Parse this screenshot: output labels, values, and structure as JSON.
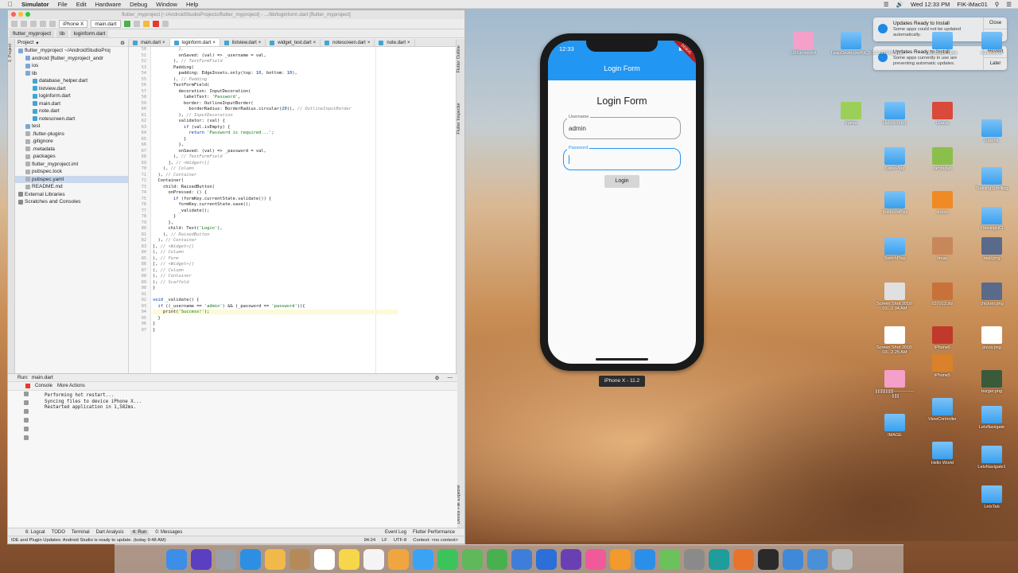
{
  "menubar": {
    "app": "Simulator",
    "menus": [
      "File",
      "Edit",
      "Hardware",
      "Debug",
      "Window",
      "Help"
    ],
    "datetime": "Wed 12:33 PM",
    "user": "FIK-iMac01"
  },
  "ide": {
    "title": "flutter_myproject [~/AndroidStudioProjects/flutter_myproject] - .../lib/loginform.dart [flutter_myproject]",
    "toolbar": {
      "device": "iPhone X",
      "run_config": "main.dart"
    },
    "breadcrumbs": [
      "flutter_myproject",
      "lib",
      "loginform.dart"
    ],
    "project_header": "Project",
    "tree": [
      {
        "label": "flutter_myproject  ~/AndroidStudioProj",
        "indent": 0,
        "kind": "folder"
      },
      {
        "label": "android [flutter_myproject_andr",
        "indent": 1,
        "kind": "folder"
      },
      {
        "label": "ios",
        "indent": 1,
        "kind": "folder"
      },
      {
        "label": "lib",
        "indent": 1,
        "kind": "folder"
      },
      {
        "label": "database_helper.dart",
        "indent": 2,
        "kind": "dart"
      },
      {
        "label": "listview.dart",
        "indent": 2,
        "kind": "dart"
      },
      {
        "label": "loginform.dart",
        "indent": 2,
        "kind": "dart"
      },
      {
        "label": "main.dart",
        "indent": 2,
        "kind": "dart"
      },
      {
        "label": "note.dart",
        "indent": 2,
        "kind": "dart"
      },
      {
        "label": "notescreen.dart",
        "indent": 2,
        "kind": "dart"
      },
      {
        "label": "test",
        "indent": 1,
        "kind": "folder"
      },
      {
        "label": ".flutter-plugins",
        "indent": 1,
        "kind": "file"
      },
      {
        "label": ".gitignore",
        "indent": 1,
        "kind": "file"
      },
      {
        "label": ".metadata",
        "indent": 1,
        "kind": "file"
      },
      {
        "label": ".packages",
        "indent": 1,
        "kind": "file"
      },
      {
        "label": "flutter_myproject.iml",
        "indent": 1,
        "kind": "file"
      },
      {
        "label": "pubspec.lock",
        "indent": 1,
        "kind": "file"
      },
      {
        "label": "pubspec.yaml",
        "indent": 1,
        "kind": "file",
        "selected": true
      },
      {
        "label": "README.md",
        "indent": 1,
        "kind": "file"
      },
      {
        "label": "External Libraries",
        "indent": 0,
        "kind": "lib"
      },
      {
        "label": "Scratches and Consoles",
        "indent": 0,
        "kind": "lib"
      }
    ],
    "tabs": [
      "main.dart",
      "loginform.dart",
      "listview.dart",
      "widget_test.dart",
      "notescreen.dart",
      "note.dart"
    ],
    "active_tab": "loginform.dart",
    "side_labels_left": [
      "1: Project",
      "Build Variants",
      "Layout Captures",
      "2: Structure",
      "2: Favorites"
    ],
    "side_labels_right": [
      "Flutter Outline",
      "Flutter Inspector",
      "Device File Explorer"
    ],
    "run": {
      "label": "Run:",
      "config": "main.dart",
      "console_tab": "Console",
      "more_actions": "More Actions",
      "output": [
        "Performing hot restart...",
        "Syncing files to device iPhone X...",
        "Restarted application in 1,582ms."
      ]
    },
    "bottom_tabs": [
      "6: Logcat",
      "TODO",
      "Terminal",
      "Dart Analysis",
      "4: Run",
      "0: Messages"
    ],
    "bottom_right_tabs": [
      "Event Log",
      "Flutter Performance"
    ],
    "status": {
      "message": "IDE and Plugin Updates: Android Studio is ready to update. (today 9:48 AM)",
      "position": "94:24",
      "line_sep": "LF",
      "encoding": "UTF-8",
      "context": "Context: <no context>"
    }
  },
  "simulator": {
    "time": "12:33",
    "app_title": "Login Form",
    "form_title": "Login Form",
    "username_label": "Username",
    "username_value": "admin",
    "password_label": "Password",
    "login_button": "Login",
    "device_label": "iPhone X - 11.2",
    "debug_banner": "DEBUG"
  },
  "notifications": [
    {
      "title": "Updates Ready to Install",
      "body": "Some apps could not be updated automatically.",
      "action1": "Close",
      "action2": "Details"
    },
    {
      "title": "Updates Ready to Install",
      "body": "Some apps currently in use are preventing automatic updates.",
      "action1": "Restart",
      "action2": "Later"
    }
  ],
  "desktop_icons": [
    {
      "label": "LMGimmick4",
      "kind": "app"
    },
    {
      "label": "LeapDeveloperKit_2.3.1+31549_mac",
      "kind": "folder"
    },
    {
      "label": "LetsStaticTable",
      "kind": "folder"
    },
    {
      "label": "HelloWorld",
      "kind": "folder"
    },
    {
      "label": "mama",
      "kind": "image"
    },
    {
      "label": "HelloWorld1",
      "kind": "folder"
    },
    {
      "label": "Guava",
      "kind": "image"
    },
    {
      "label": "Graphic",
      "kind": "folder"
    },
    {
      "label": "LabelPlay",
      "kind": "folder"
    },
    {
      "label": "rambutan",
      "kind": "image"
    },
    {
      "label": "TrainingScrolling",
      "kind": "folder"
    },
    {
      "label": "TextFieldPlay",
      "kind": "folder"
    },
    {
      "label": "durian",
      "kind": "image"
    },
    {
      "label": "TrainingHCI",
      "kind": "folder"
    },
    {
      "label": "SwitchPlay",
      "kind": "folder"
    },
    {
      "label": "limau",
      "kind": "image"
    },
    {
      "label": "nasi.png",
      "kind": "image"
    },
    {
      "label": "Screen Shot 2018-03...2.04 AM",
      "kind": "image"
    },
    {
      "label": "037912.zip",
      "kind": "file"
    },
    {
      "label": "chicken.png",
      "kind": "image"
    },
    {
      "label": "Screen Shot 2018-03...2.25 AM",
      "kind": "image"
    },
    {
      "label": "iPhone6",
      "kind": "file"
    },
    {
      "label": "pizza.png",
      "kind": "image"
    },
    {
      "label": "iPhone5",
      "kind": "file"
    },
    {
      "label": "burger.png",
      "kind": "image"
    },
    {
      "label": "||||||||||||||||---------------||||||",
      "kind": "image"
    },
    {
      "label": "ViewController",
      "kind": "folder"
    },
    {
      "label": "LetsNavigate",
      "kind": "folder"
    },
    {
      "label": "IMAGE",
      "kind": "folder"
    },
    {
      "label": "Hello World",
      "kind": "folder"
    },
    {
      "label": "LetsNavigate1",
      "kind": "folder"
    },
    {
      "label": "LetsTab",
      "kind": "folder"
    }
  ],
  "dock_icons": [
    "finder-icon",
    "siri-icon",
    "launchpad-icon",
    "safari-icon",
    "preview-icon",
    "contacts-icon",
    "calendar-icon",
    "notes-icon",
    "reminders-icon",
    "photos-icon",
    "messages-icon",
    "facetime-icon",
    "maps-icon",
    "numbers-icon",
    "keynote-icon",
    "xcode-icon",
    "visual-studio-icon",
    "itunes-icon",
    "ibooks-icon",
    "app-store-icon",
    "android-studio-icon",
    "system-preferences-icon",
    "maya-icon",
    "blender-icon",
    "terminal-icon",
    "simulator-icon",
    "documents-folder-icon",
    "trash-icon"
  ],
  "dock_colors": [
    "#3d8ee6",
    "#5a3fc0",
    "#9aa0a6",
    "#2d8fe4",
    "#f0b94a",
    "#b58a5a",
    "#ffffff",
    "#f6d64a",
    "#f4f4f4",
    "#f0a640",
    "#3ba3f5",
    "#3cc45a",
    "#5fb85a",
    "#49b04f",
    "#3f7ed8",
    "#2b6fd8",
    "#6a3fb4",
    "#f05a9a",
    "#f39a2c",
    "#2b8fe9",
    "#6bc25a",
    "#8a8a8a",
    "#1f9c9c",
    "#e8742c",
    "#2a2a2a",
    "#3f8ad8",
    "#4a90d9",
    "#bcbcbc"
  ],
  "accent": "#2196f3"
}
